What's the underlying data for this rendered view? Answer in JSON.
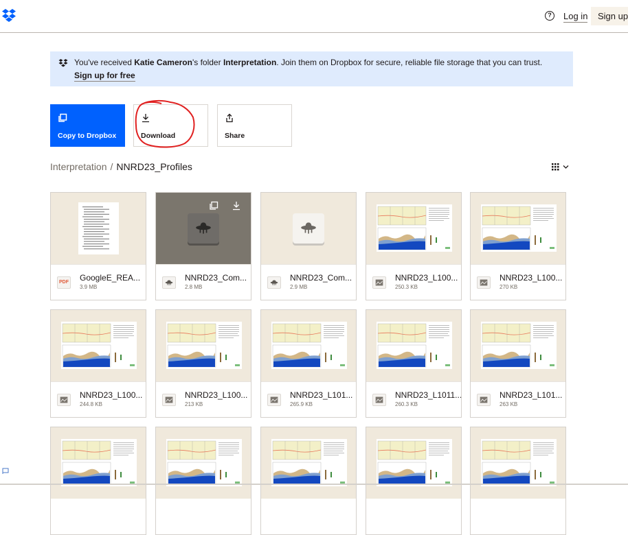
{
  "header": {
    "logo": "dropbox-logo",
    "help_icon": "?",
    "login_label": "Log in",
    "signup_label": "Sign up"
  },
  "banner": {
    "prefix": "You've received ",
    "owner": "Katie Cameron",
    "middle": "'s folder ",
    "folder": "Interpretation",
    "suffix": ". Join them on Dropbox for secure, reliable file storage that you can trust.",
    "signup_link": "Sign up for free"
  },
  "actions": {
    "copy_label": "Copy to Dropbox",
    "download_label": "Download",
    "share_label": "Share"
  },
  "breadcrumb": {
    "parent": "Interpretation",
    "separator": "/",
    "current": "NNRD23_Profiles"
  },
  "colors": {
    "brand": "#0061fe",
    "banner_bg": "#dfebfd",
    "thumb_bg": "#f0e9dc",
    "annotation": "#e02020"
  },
  "files": [
    {
      "name": "GoogleE_REA...",
      "size": "3.9 MB",
      "type": "pdf",
      "icon_label": "PDF"
    },
    {
      "name": "NNRD23_Com...",
      "size": "2.8 MB",
      "type": "ufo"
    },
    {
      "name": "NNRD23_Com...",
      "size": "2.9 MB",
      "type": "ufo"
    },
    {
      "name": "NNRD23_L100...",
      "size": "250.3 KB",
      "type": "image"
    },
    {
      "name": "NNRD23_L100...",
      "size": "270 KB",
      "type": "image"
    },
    {
      "name": "NNRD23_L100...",
      "size": "244.8 KB",
      "type": "image"
    },
    {
      "name": "NNRD23_L100...",
      "size": "213 KB",
      "type": "image"
    },
    {
      "name": "NNRD23_L101...",
      "size": "265.9 KB",
      "type": "image"
    },
    {
      "name": "NNRD23_L1011...",
      "size": "260.3 KB",
      "type": "image"
    },
    {
      "name": "NNRD23_L101...",
      "size": "263 KB",
      "type": "image"
    }
  ]
}
